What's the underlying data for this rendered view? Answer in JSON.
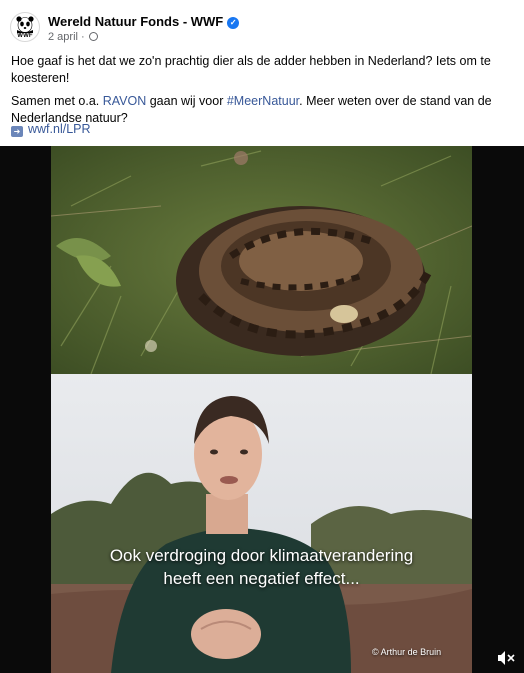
{
  "page": {
    "avatar_text": "WWF",
    "name": "Wereld Natuur Fonds - WWF",
    "verified_icon": "verified-badge-icon",
    "date": "2 april",
    "separator": "·",
    "audience_icon": "globe-icon"
  },
  "post": {
    "line1": "Hoe gaaf is het dat we zo'n prachtig dier als de adder hebben in Nederland? Iets om te koesteren!",
    "line2_prefix": "Samen met o.a. ",
    "line2_link": "RAVON",
    "line2_middle": " gaan wij voor ",
    "line2_hashtag": "#MeerNatuur",
    "line2_suffix": ". Meer weten over de stand van de Nederlandse natuur?",
    "url": "wwf.nl/LPR",
    "url_icon": "link-arrow-icon"
  },
  "video": {
    "caption_line1": "Ook verdroging door klimaatverandering",
    "caption_line2": "heeft een negatief effect...",
    "credit": "© Arthur de Bruin",
    "mute_icon": "speaker-muted-icon"
  },
  "colors": {
    "link": "#385898",
    "verified": "#1877f2",
    "meta": "#65676b"
  }
}
